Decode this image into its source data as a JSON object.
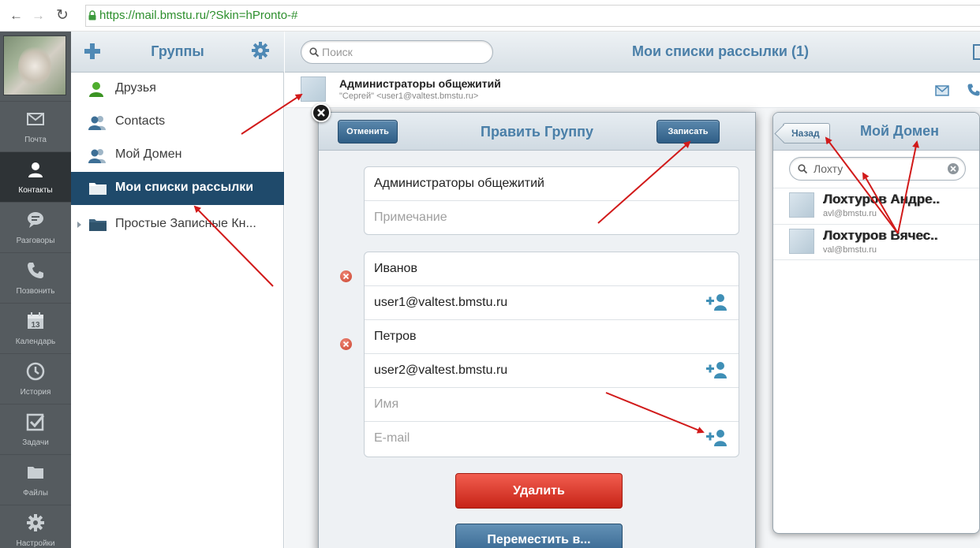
{
  "browser": {
    "url": "https://mail.bmstu.ru/?Skin=hPronto-#"
  },
  "nav": {
    "items": [
      {
        "label": "Почта",
        "icon": "envelope-icon"
      },
      {
        "label": "Контакты",
        "icon": "person-icon"
      },
      {
        "label": "Разговоры",
        "icon": "chat-icon"
      },
      {
        "label": "Позвонить",
        "icon": "phone-icon"
      },
      {
        "label": "Календарь",
        "icon": "calendar-icon",
        "day": "13"
      },
      {
        "label": "История",
        "icon": "clock-icon"
      },
      {
        "label": "Задачи",
        "icon": "checkbox-icon"
      },
      {
        "label": "Файлы",
        "icon": "folder-icon"
      },
      {
        "label": "Настройки",
        "icon": "gear-icon"
      }
    ]
  },
  "groups": {
    "title": "Группы",
    "items": [
      {
        "label": "Друзья"
      },
      {
        "label": "Contacts"
      },
      {
        "label": "Мой Домен"
      },
      {
        "label": "Мои списки рассылки"
      },
      {
        "label": "Простые Записные Кн..."
      }
    ]
  },
  "main": {
    "search_placeholder": "Поиск",
    "title": "Мои списки рассылки (1)",
    "contact": {
      "name": "Администраторы общежитий",
      "email": "\"Сергей\" <user1@valtest.bmstu.ru>"
    }
  },
  "dialog": {
    "title": "Править Группу",
    "cancel_label": "Отменить",
    "save_label": "Записать",
    "group_name": "Администраторы общежитий",
    "note_placeholder": "Примечание",
    "members": [
      {
        "name": "Иванов",
        "email": "user1@valtest.bmstu.ru"
      },
      {
        "name": "Петров",
        "email": "user2@valtest.bmstu.ru"
      }
    ],
    "new_name_placeholder": "Имя",
    "new_email_placeholder": "E-mail",
    "delete_label": "Удалить",
    "move_label": "Переместить в..."
  },
  "right_panel": {
    "back_label": "Назад",
    "title": "Мой Домен",
    "search_value": "Лохту",
    "contacts": [
      {
        "name": "Лохтуров Андре..",
        "email": "avl@bmstu.ru"
      },
      {
        "name": "Лохтуров Вячес..",
        "email": "val@bmstu.ru"
      }
    ]
  },
  "colors": {
    "accent": "#4a7fa8",
    "sidebar": "#555b5f",
    "selected_group": "#1f4a6b",
    "delete_button": "#d93a2c",
    "annotation_arrow": "#d11a1a"
  }
}
